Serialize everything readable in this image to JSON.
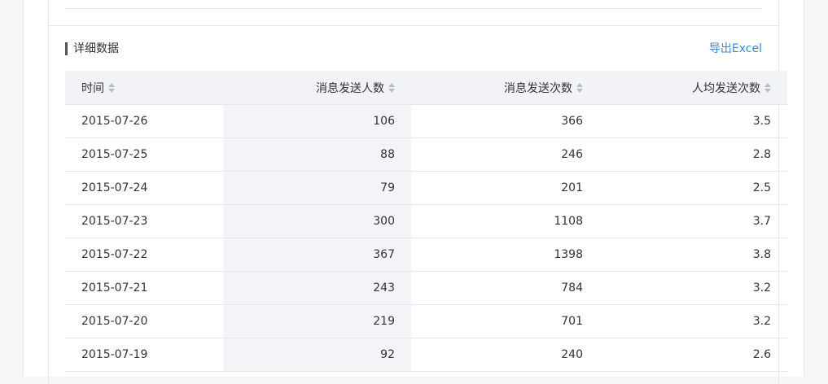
{
  "section": {
    "title": "详细数据",
    "export_label": "导出Excel"
  },
  "table": {
    "headers": [
      "时间",
      "消息发送人数",
      "消息发送次数",
      "人均发送次数"
    ],
    "rows": [
      [
        "2015-07-26",
        "106",
        "366",
        "3.5"
      ],
      [
        "2015-07-25",
        "88",
        "246",
        "2.8"
      ],
      [
        "2015-07-24",
        "79",
        "201",
        "2.5"
      ],
      [
        "2015-07-23",
        "300",
        "1108",
        "3.7"
      ],
      [
        "2015-07-22",
        "367",
        "1398",
        "3.8"
      ],
      [
        "2015-07-21",
        "243",
        "784",
        "3.2"
      ],
      [
        "2015-07-20",
        "219",
        "701",
        "3.2"
      ],
      [
        "2015-07-19",
        "92",
        "240",
        "2.6"
      ]
    ]
  },
  "colors": {
    "link": "#3c8ad6",
    "header_bg": "#f2f3f7",
    "highlight_col_bg": "#f3f4f8"
  },
  "icons": {
    "sort": "sort-icon"
  }
}
